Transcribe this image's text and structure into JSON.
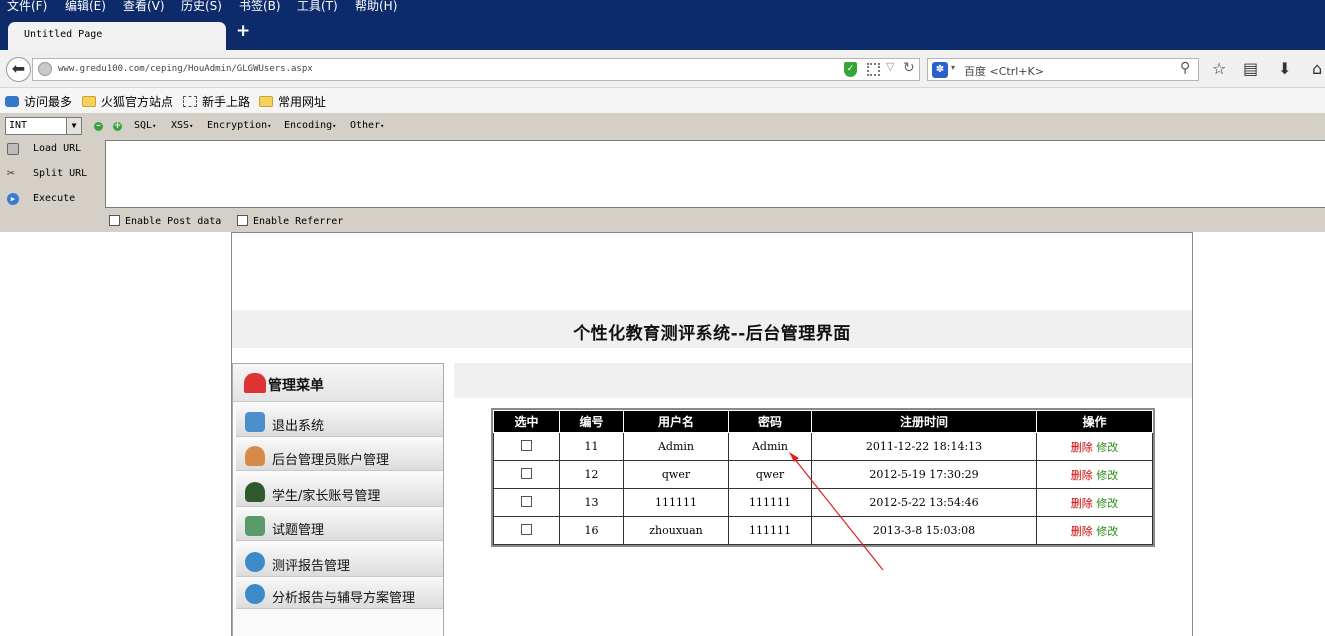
{
  "menubar": {
    "items": [
      "文件(F)",
      "编辑(E)",
      "查看(V)",
      "历史(S)",
      "书签(B)",
      "工具(T)",
      "帮助(H)"
    ]
  },
  "tab": {
    "title": "Untitled Page",
    "new_tab": "+"
  },
  "nav": {
    "url": "www.gredu100.com/ceping/HouAdmin/GLGWUsers.aspx",
    "search_engine": "百度",
    "search_placeholder": "百度 <Ctrl+K>"
  },
  "bookmarks": {
    "items": [
      "访问最多",
      "火狐官方站点",
      "新手上路",
      "常用网址"
    ]
  },
  "hackbar": {
    "type_select": "INT",
    "menus": [
      "SQL",
      "XSS",
      "Encryption",
      "Encoding",
      "Other"
    ],
    "load_url": "Load URL",
    "split_url": "Split URL",
    "execute": "Execute",
    "enable_post": "Enable Post data",
    "enable_referrer": "Enable Referrer"
  },
  "page": {
    "title": "个性化教育测评系统--后台管理界面",
    "menu_title": "管理菜单",
    "menu_items": [
      "退出系统",
      "后台管理员账户管理",
      "学生/家长账号管理",
      "试题管理",
      "测评报告管理",
      "分析报告与辅导方案管理"
    ]
  },
  "table": {
    "headers": [
      "选中",
      "编号",
      "用户名",
      "密码",
      "注册时间",
      "操作"
    ],
    "delete_label": "删除",
    "edit_label": "修改",
    "rows": [
      {
        "id": "11",
        "username": "Admin",
        "password": "Admin",
        "time": "2011-12-22 18:14:13"
      },
      {
        "id": "12",
        "username": "qwer",
        "password": "qwer",
        "time": "2012-5-19 17:30:29"
      },
      {
        "id": "13",
        "username": "111111",
        "password": "111111",
        "time": "2012-5-22 13:54:46"
      },
      {
        "id": "16",
        "username": "zhouxuan",
        "password": "111111",
        "time": "2013-3-8 15:03:08"
      }
    ]
  },
  "colors": {
    "menubar_bg": "#0d2b6b",
    "delete": "#cc0000",
    "edit": "#2e8b1a",
    "annotation_arrow": "#e02020"
  }
}
